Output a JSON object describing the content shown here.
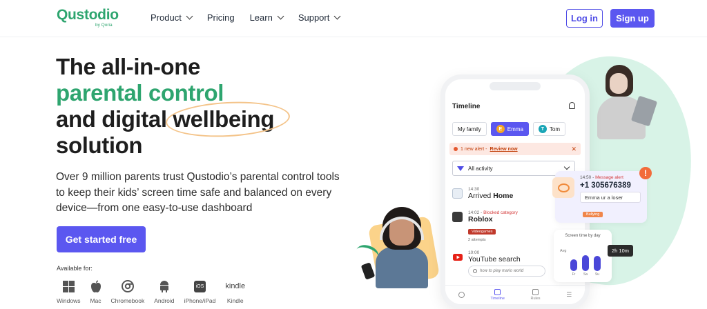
{
  "brand": {
    "name": "Qustodio",
    "sub": "by Qoria",
    "color": "#2ea56f",
    "accent": "#5b57f0"
  },
  "nav": {
    "items": [
      {
        "label": "Product",
        "dropdown": true
      },
      {
        "label": "Pricing",
        "dropdown": false
      },
      {
        "label": "Learn",
        "dropdown": true
      },
      {
        "label": "Support",
        "dropdown": true
      }
    ],
    "login": "Log in",
    "signup": "Sign up"
  },
  "hero": {
    "line1": "The all-in-one",
    "line2": "parental control",
    "line3a": "and digital ",
    "line3b": "wellbeing",
    "line4": "solution",
    "subtext": "Over 9 million parents trust Qustodio’s parental control tools to keep their kids’ screen time safe and balanced on every device—from one easy-to-use dashboard",
    "cta": "Get started free",
    "available_for": "Available for:",
    "platforms": [
      {
        "label": "Windows",
        "icon": "windows-icon"
      },
      {
        "label": "Mac",
        "icon": "apple-icon"
      },
      {
        "label": "Chromebook",
        "icon": "chrome-icon"
      },
      {
        "label": "Android",
        "icon": "android-icon"
      },
      {
        "label": "iPhone/iPad",
        "icon": "ios-icon",
        "badge": "iOS"
      },
      {
        "label": "Kindle",
        "icon": "kindle-icon",
        "badge": "kindle"
      }
    ]
  },
  "phone": {
    "title": "Timeline",
    "chips": [
      {
        "label": "My family",
        "initial": "",
        "color": ""
      },
      {
        "label": "Emma",
        "initial": "E",
        "color": "#f5a623",
        "active": true
      },
      {
        "label": "Tom",
        "initial": "T",
        "color": "#1aa6b7"
      }
    ],
    "alert": {
      "text": "1 new alert - ",
      "link": "Review now"
    },
    "filter": "All activity",
    "events": [
      {
        "time": "14:30",
        "category": "",
        "prefix": "Arrived ",
        "name": "Home",
        "icon": "location-icon",
        "tag": "",
        "sub": ""
      },
      {
        "time": "14:02",
        "category": "Blocked category",
        "prefix": "",
        "name": "Roblox",
        "icon": "roblox-icon",
        "tag": "Videogames",
        "sub": "2 attempts"
      },
      {
        "time": "10:00",
        "category": "",
        "prefix": "",
        "name": "YouTube search",
        "icon": "youtube-icon",
        "tag": "",
        "sub": "",
        "search": "how to play mario world"
      }
    ],
    "tabs": [
      {
        "label": "Timeline",
        "active": true
      },
      {
        "label": "Rules",
        "active": false
      }
    ]
  },
  "message_alert": {
    "time": "14:50",
    "type": "Message alert",
    "number": "+1 305676389",
    "text": "Emma ur a loser",
    "tag": "Bullying"
  },
  "screen_time": {
    "title": "Screen time by day",
    "avg_label": "Avg",
    "days": [
      "Fr",
      "Sa",
      "Su"
    ],
    "levels": [
      0.55,
      0.75,
      0.72
    ],
    "tooltip": "2h 10m"
  }
}
